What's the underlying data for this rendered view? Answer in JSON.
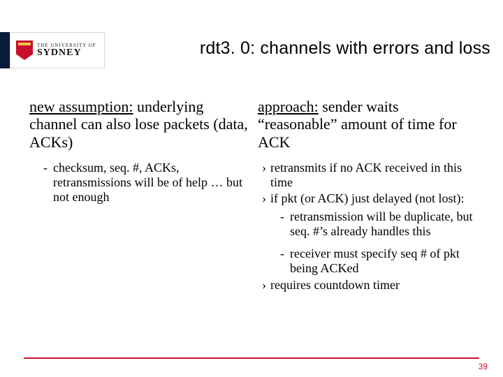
{
  "logo": {
    "top": "THE UNIVERSITY OF",
    "main": "SYDNEY"
  },
  "title": "rdt3. 0: channels with errors and loss",
  "left": {
    "lead_underlined": "new assumption:",
    "lead_rest": " underlying channel can also lose packets (data, ACKs)",
    "sub1": "checksum, seq. #, ACKs, retransmissions will be of help … but not enough"
  },
  "right": {
    "lead_underlined": "approach:",
    "lead_rest": " sender waits “reasonable” amount of time for ACK",
    "b1": "retransmits if no ACK received in this time",
    "b2": "if pkt (or ACK) just delayed (not lost):",
    "b2_s1": "retransmission will be duplicate, but seq. #’s already handles this",
    "b2_s2": "receiver must specify seq # of pkt being ACKed",
    "b3": "requires countdown timer"
  },
  "page": "39"
}
